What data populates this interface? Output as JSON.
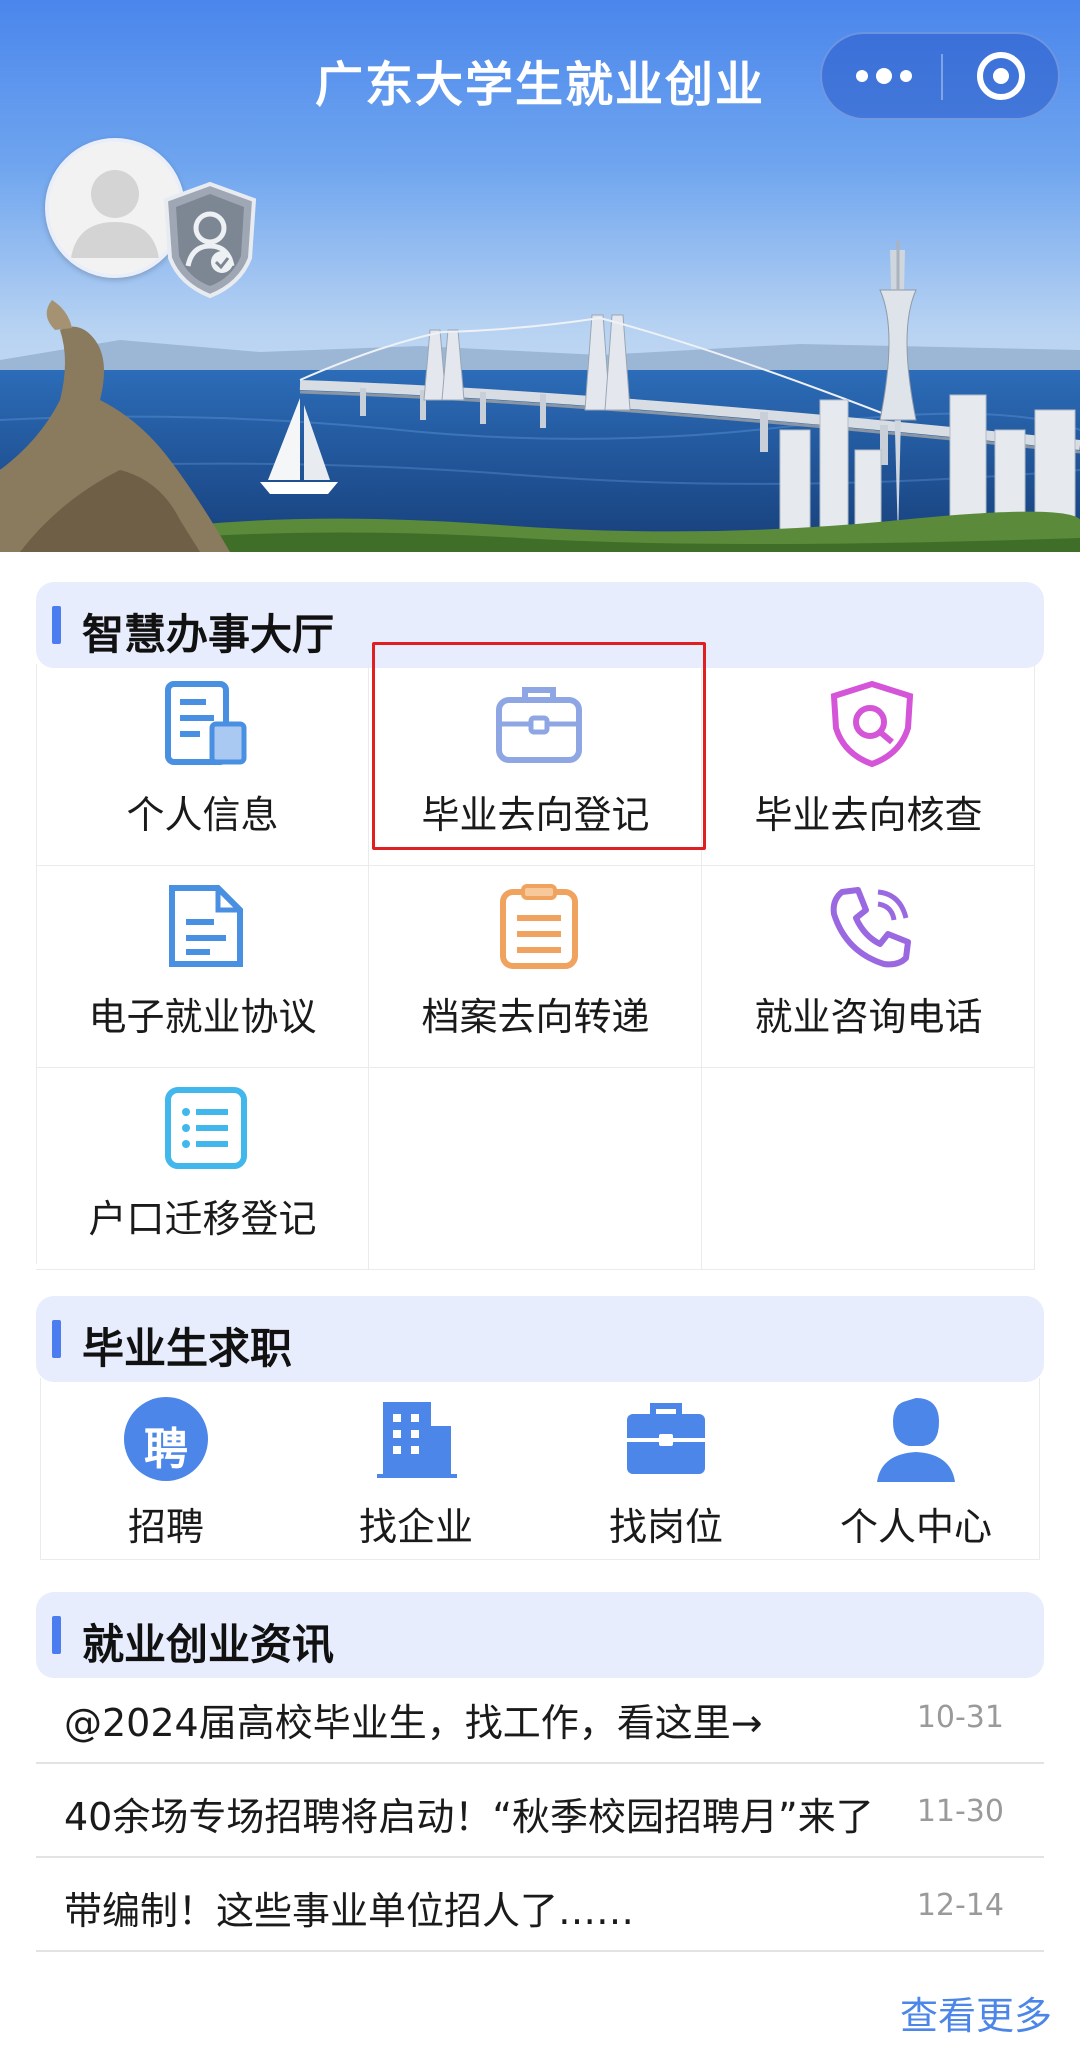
{
  "header": {
    "app_title": "广东大学生就业创业",
    "more_icon": "more-dots-icon",
    "close_icon": "target-close-icon"
  },
  "profile": {
    "avatar_icon": "user-avatar-icon",
    "badge_icon": "verified-shield-icon"
  },
  "services": {
    "title": "智慧办事大厅",
    "items": [
      {
        "label": "个人信息",
        "icon": "profile-document-icon",
        "color": "#4a90e2"
      },
      {
        "label": "毕业去向登记",
        "icon": "briefcase-icon",
        "color": "#7f9be0"
      },
      {
        "label": "毕业去向核查",
        "icon": "search-shield-icon",
        "color": "#d455d8"
      },
      {
        "label": "电子就业协议",
        "icon": "document-icon",
        "color": "#4a90e2"
      },
      {
        "label": "档案去向转递",
        "icon": "clipboard-icon",
        "color": "#f0a35e"
      },
      {
        "label": "就业咨询电话",
        "icon": "phone-icon",
        "color": "#9a68e0"
      },
      {
        "label": "户口迁移登记",
        "icon": "list-icon",
        "color": "#42b7ec"
      }
    ]
  },
  "jobs": {
    "title": "毕业生求职",
    "items": [
      {
        "label": "招聘",
        "icon_text": "聘",
        "icon": "recruit-icon"
      },
      {
        "label": "找企业",
        "icon": "building-icon"
      },
      {
        "label": "找岗位",
        "icon": "briefcase-icon"
      },
      {
        "label": "个人中心",
        "icon": "person-icon"
      }
    ],
    "color": "#4b86e8"
  },
  "news": {
    "title": "就业创业资讯",
    "items": [
      {
        "title": "@2024届高校毕业生，找工作，看这里→",
        "date": "10-31"
      },
      {
        "title": "40余场专场招聘将启动！“秋季校园招聘月”来了",
        "date": "11-30"
      },
      {
        "title": "带编制！这些事业单位招人了……",
        "date": "12-14"
      }
    ],
    "more": "查看更多"
  }
}
